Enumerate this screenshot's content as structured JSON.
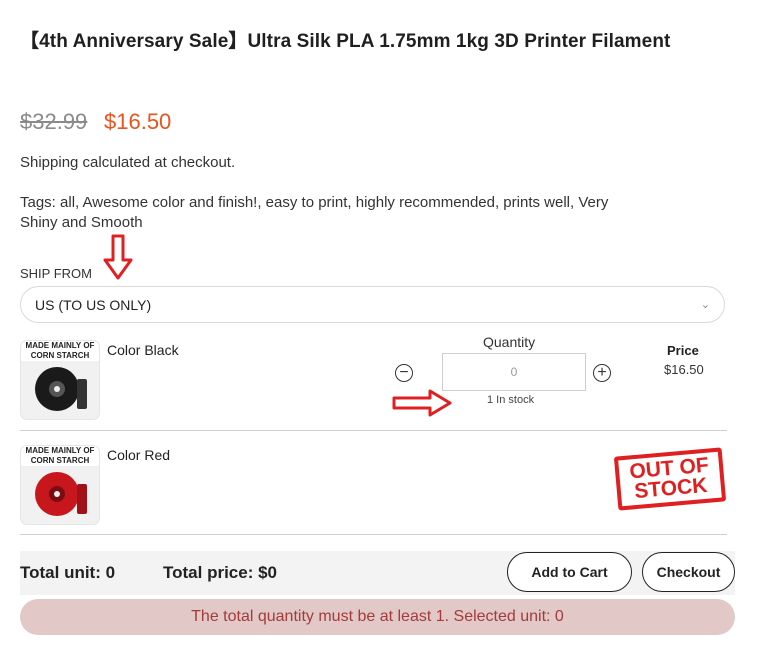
{
  "product": {
    "title": "【4th Anniversary Sale】Ultra Silk PLA 1.75mm 1kg 3D Printer Filament",
    "price_original": "$32.99",
    "price_sale": "$16.50",
    "shipping_note": "Shipping calculated at checkout.",
    "tags_text": "Tags: all, Awesome color and finish!, easy to print, highly recommended, prints well, Very Shiny and Smooth"
  },
  "ship_from": {
    "label": "SHIP FROM",
    "selected": "US (TO US ONLY)"
  },
  "variants": {
    "headers": {
      "quantity": "Quantity",
      "price": "Price"
    },
    "rows": [
      {
        "label": "Color  Black",
        "thumb_banner": "MADE MAINLY OF CORN STARCH",
        "quantity_value": "0",
        "stock_note": "1 In stock",
        "price": "$16.50",
        "swatch": "#1a1a1a"
      },
      {
        "label": "Color  Red",
        "thumb_banner": "MADE MAINLY OF CORN STARCH",
        "out_of_stock_line1": "OUT OF",
        "out_of_stock_line2": "STOCK",
        "swatch": "#c8161d"
      }
    ]
  },
  "summary": {
    "total_unit": "Total unit: 0",
    "total_price": "Total price:  $0",
    "add_to_cart": "Add to Cart",
    "checkout": "Checkout",
    "warning": "The total quantity must be at least 1. Selected unit: 0"
  },
  "colors": {
    "sale": "#e8541e",
    "annotation_arrow": "#e02020",
    "warning_bg": "#e3c8c8",
    "warning_text": "#a33b3b"
  }
}
